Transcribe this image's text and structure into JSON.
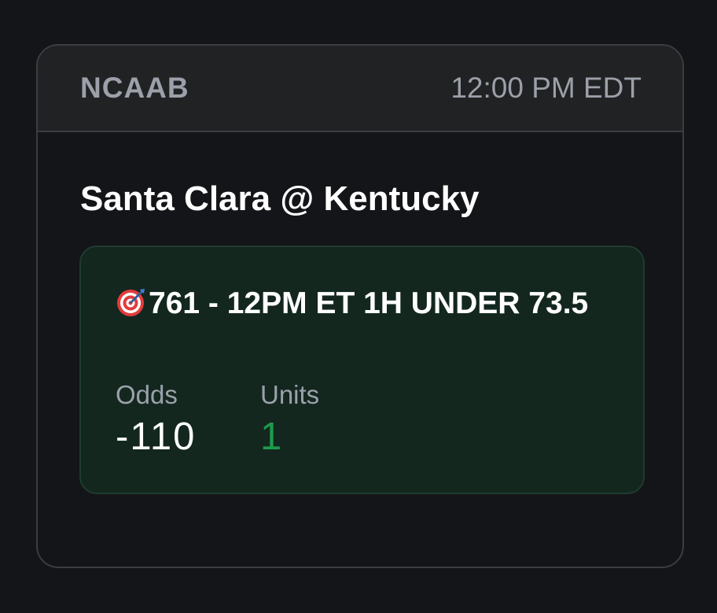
{
  "card": {
    "league": "NCAAB",
    "time": "12:00 PM EDT",
    "matchup": "Santa Clara @ Kentucky",
    "pick": {
      "icon": "target-icon",
      "title": "761 - 12PM ET 1H UNDER 73.5",
      "odds_label": "Odds",
      "odds_value": "-110",
      "units_label": "Units",
      "units_value": "1"
    }
  },
  "colors": {
    "background": "#141518",
    "header": "#212224",
    "pick_background": "#13271f",
    "units_accent": "#1e9a4a"
  }
}
